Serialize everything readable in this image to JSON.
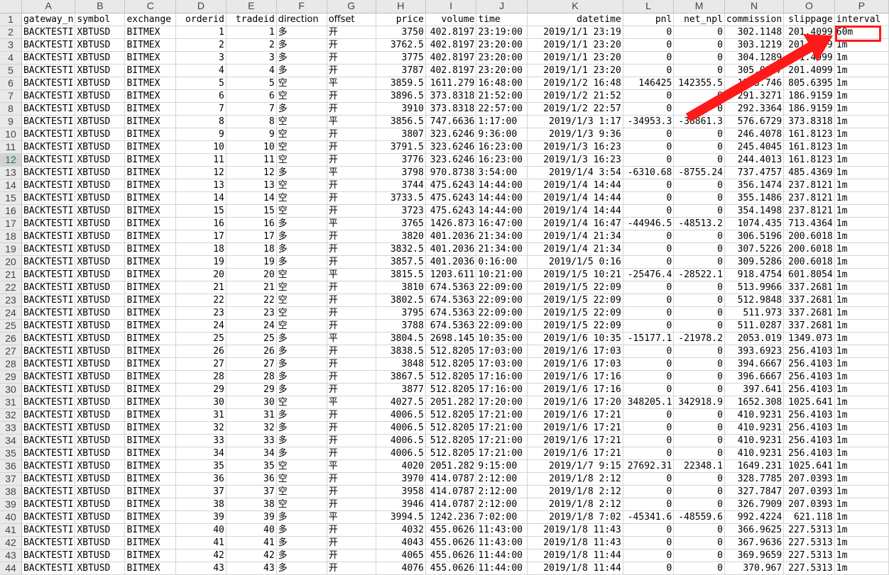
{
  "columns": [
    "A",
    "B",
    "C",
    "D",
    "E",
    "F",
    "G",
    "H",
    "I",
    "J",
    "K",
    "L",
    "M",
    "N",
    "O",
    "P"
  ],
  "header_row": [
    "gateway_n",
    "symbol",
    "exchange",
    "orderid",
    "tradeid",
    "direction",
    "offset",
    "price",
    "volume",
    "time",
    "datetime",
    "pnl",
    "net_npl",
    "commission",
    "slippage",
    "interval"
  ],
  "rows": [
    [
      "BACKTESTI",
      "XBTUSD",
      "BITMEX",
      "1",
      "1",
      "多",
      "开",
      "3750",
      "402.8197",
      "23:19:00",
      "2019/1/1  23:19",
      "0",
      "0",
      "302.1148",
      "201.4099",
      "60m"
    ],
    [
      "BACKTESTI",
      "XBTUSD",
      "BITMEX",
      "2",
      "2",
      "多",
      "开",
      "3762.5",
      "402.8197",
      "23:20:00",
      "2019/1/1  23:20",
      "0",
      "0",
      "303.1219",
      "201.4099",
      "1m"
    ],
    [
      "BACKTESTI",
      "XBTUSD",
      "BITMEX",
      "3",
      "3",
      "多",
      "开",
      "3775",
      "402.8197",
      "23:20:00",
      "2019/1/1  23:20",
      "0",
      "0",
      "304.1289",
      "201.4099",
      "1m"
    ],
    [
      "BACKTESTI",
      "XBTUSD",
      "BITMEX",
      "4",
      "4",
      "多",
      "开",
      "3787",
      "402.8197",
      "23:20:00",
      "2019/1/1  23:20",
      "0",
      "0",
      "305.0847",
      "201.4099",
      "1m"
    ],
    [
      "BACKTESTI",
      "XBTUSD",
      "BITMEX",
      "5",
      "5",
      "空",
      "平",
      "3859.5",
      "1611.279",
      "16:48:00",
      "2019/1/2  16:48",
      "146425",
      "142355.5",
      "1243.746",
      "805.6395",
      "1m"
    ],
    [
      "BACKTESTI",
      "XBTUSD",
      "BITMEX",
      "6",
      "6",
      "空",
      "开",
      "3896.5",
      "373.8318",
      "21:52:00",
      "2019/1/2  21:52",
      "0",
      "0",
      "291.3271",
      "186.9159",
      "1m"
    ],
    [
      "BACKTESTI",
      "XBTUSD",
      "BITMEX",
      "7",
      "7",
      "多",
      "开",
      "3910",
      "373.8318",
      "22:57:00",
      "2019/1/2  22:57",
      "0",
      "0",
      "292.3364",
      "186.9159",
      "1m"
    ],
    [
      "BACKTESTI",
      "XBTUSD",
      "BITMEX",
      "8",
      "8",
      "空",
      "平",
      "3856.5",
      "747.6636",
      "1:17:00",
      "2019/1/3  1:17",
      "-34953.3",
      "-36861.3",
      "576.6729",
      "373.8318",
      "1m"
    ],
    [
      "BACKTESTI",
      "XBTUSD",
      "BITMEX",
      "9",
      "9",
      "空",
      "开",
      "3807",
      "323.6246",
      "9:36:00",
      "2019/1/3  9:36",
      "0",
      "0",
      "246.4078",
      "161.8123",
      "1m"
    ],
    [
      "BACKTESTI",
      "XBTUSD",
      "BITMEX",
      "10",
      "10",
      "空",
      "开",
      "3791.5",
      "323.6246",
      "16:23:00",
      "2019/1/3  16:23",
      "0",
      "0",
      "245.4045",
      "161.8123",
      "1m"
    ],
    [
      "BACKTESTI",
      "XBTUSD",
      "BITMEX",
      "11",
      "11",
      "空",
      "开",
      "3776",
      "323.6246",
      "16:23:00",
      "2019/1/3  16:23",
      "0",
      "0",
      "244.4013",
      "161.8123",
      "1m"
    ],
    [
      "BACKTESTI",
      "XBTUSD",
      "BITMEX",
      "12",
      "12",
      "多",
      "平",
      "3798",
      "970.8738",
      "3:54:00",
      "2019/1/4  3:54",
      "-6310.68",
      "-8755.24",
      "737.4757",
      "485.4369",
      "1m"
    ],
    [
      "BACKTESTI",
      "XBTUSD",
      "BITMEX",
      "13",
      "13",
      "空",
      "开",
      "3744",
      "475.6243",
      "14:44:00",
      "2019/1/4  14:44",
      "0",
      "0",
      "356.1474",
      "237.8121",
      "1m"
    ],
    [
      "BACKTESTI",
      "XBTUSD",
      "BITMEX",
      "14",
      "14",
      "空",
      "开",
      "3733.5",
      "475.6243",
      "14:44:00",
      "2019/1/4  14:44",
      "0",
      "0",
      "355.1486",
      "237.8121",
      "1m"
    ],
    [
      "BACKTESTI",
      "XBTUSD",
      "BITMEX",
      "15",
      "15",
      "空",
      "开",
      "3723",
      "475.6243",
      "14:44:00",
      "2019/1/4  14:44",
      "0",
      "0",
      "354.1498",
      "237.8121",
      "1m"
    ],
    [
      "BACKTESTI",
      "XBTUSD",
      "BITMEX",
      "16",
      "16",
      "多",
      "平",
      "3765",
      "1426.873",
      "16:47:00",
      "2019/1/4  16:47",
      "-44946.5",
      "-48513.2",
      "1074.435",
      "713.4364",
      "1m"
    ],
    [
      "BACKTESTI",
      "XBTUSD",
      "BITMEX",
      "17",
      "17",
      "多",
      "开",
      "3820",
      "401.2036",
      "21:34:00",
      "2019/1/4  21:34",
      "0",
      "0",
      "306.5196",
      "200.6018",
      "1m"
    ],
    [
      "BACKTESTI",
      "XBTUSD",
      "BITMEX",
      "18",
      "18",
      "多",
      "开",
      "3832.5",
      "401.2036",
      "21:34:00",
      "2019/1/4  21:34",
      "0",
      "0",
      "307.5226",
      "200.6018",
      "1m"
    ],
    [
      "BACKTESTI",
      "XBTUSD",
      "BITMEX",
      "19",
      "19",
      "多",
      "开",
      "3857.5",
      "401.2036",
      "0:16:00",
      "2019/1/5  0:16",
      "0",
      "0",
      "309.5286",
      "200.6018",
      "1m"
    ],
    [
      "BACKTESTI",
      "XBTUSD",
      "BITMEX",
      "20",
      "20",
      "空",
      "平",
      "3815.5",
      "1203.611",
      "10:21:00",
      "2019/1/5  10:21",
      "-25476.4",
      "-28522.1",
      "918.4754",
      "601.8054",
      "1m"
    ],
    [
      "BACKTESTI",
      "XBTUSD",
      "BITMEX",
      "21",
      "21",
      "空",
      "开",
      "3810",
      "674.5363",
      "22:09:00",
      "2019/1/5  22:09",
      "0",
      "0",
      "513.9966",
      "337.2681",
      "1m"
    ],
    [
      "BACKTESTI",
      "XBTUSD",
      "BITMEX",
      "22",
      "22",
      "空",
      "开",
      "3802.5",
      "674.5363",
      "22:09:00",
      "2019/1/5  22:09",
      "0",
      "0",
      "512.9848",
      "337.2681",
      "1m"
    ],
    [
      "BACKTESTI",
      "XBTUSD",
      "BITMEX",
      "23",
      "23",
      "空",
      "开",
      "3795",
      "674.5363",
      "22:09:00",
      "2019/1/5  22:09",
      "0",
      "0",
      "511.973",
      "337.2681",
      "1m"
    ],
    [
      "BACKTESTI",
      "XBTUSD",
      "BITMEX",
      "24",
      "24",
      "空",
      "开",
      "3788",
      "674.5363",
      "22:09:00",
      "2019/1/5  22:09",
      "0",
      "0",
      "511.0287",
      "337.2681",
      "1m"
    ],
    [
      "BACKTESTI",
      "XBTUSD",
      "BITMEX",
      "25",
      "25",
      "多",
      "平",
      "3804.5",
      "2698.145",
      "10:35:00",
      "2019/1/6  10:35",
      "-15177.1",
      "-21978.2",
      "2053.019",
      "1349.073",
      "1m"
    ],
    [
      "BACKTESTI",
      "XBTUSD",
      "BITMEX",
      "26",
      "26",
      "多",
      "开",
      "3838.5",
      "512.8205",
      "17:03:00",
      "2019/1/6  17:03",
      "0",
      "0",
      "393.6923",
      "256.4103",
      "1m"
    ],
    [
      "BACKTESTI",
      "XBTUSD",
      "BITMEX",
      "27",
      "27",
      "多",
      "开",
      "3848",
      "512.8205",
      "17:03:00",
      "2019/1/6  17:03",
      "0",
      "0",
      "394.6667",
      "256.4103",
      "1m"
    ],
    [
      "BACKTESTI",
      "XBTUSD",
      "BITMEX",
      "28",
      "28",
      "多",
      "开",
      "3867.5",
      "512.8205",
      "17:16:00",
      "2019/1/6  17:16",
      "0",
      "0",
      "396.6667",
      "256.4103",
      "1m"
    ],
    [
      "BACKTESTI",
      "XBTUSD",
      "BITMEX",
      "29",
      "29",
      "多",
      "开",
      "3877",
      "512.8205",
      "17:16:00",
      "2019/1/6  17:16",
      "0",
      "0",
      "397.641",
      "256.4103",
      "1m"
    ],
    [
      "BACKTESTI",
      "XBTUSD",
      "BITMEX",
      "30",
      "30",
      "空",
      "平",
      "4027.5",
      "2051.282",
      "17:20:00",
      "2019/1/6  17:20",
      "348205.1",
      "342918.9",
      "1652.308",
      "1025.641",
      "1m"
    ],
    [
      "BACKTESTI",
      "XBTUSD",
      "BITMEX",
      "31",
      "31",
      "多",
      "开",
      "4006.5",
      "512.8205",
      "17:21:00",
      "2019/1/6  17:21",
      "0",
      "0",
      "410.9231",
      "256.4103",
      "1m"
    ],
    [
      "BACKTESTI",
      "XBTUSD",
      "BITMEX",
      "32",
      "32",
      "多",
      "开",
      "4006.5",
      "512.8205",
      "17:21:00",
      "2019/1/6  17:21",
      "0",
      "0",
      "410.9231",
      "256.4103",
      "1m"
    ],
    [
      "BACKTESTI",
      "XBTUSD",
      "BITMEX",
      "33",
      "33",
      "多",
      "开",
      "4006.5",
      "512.8205",
      "17:21:00",
      "2019/1/6  17:21",
      "0",
      "0",
      "410.9231",
      "256.4103",
      "1m"
    ],
    [
      "BACKTESTI",
      "XBTUSD",
      "BITMEX",
      "34",
      "34",
      "多",
      "开",
      "4006.5",
      "512.8205",
      "17:21:00",
      "2019/1/6  17:21",
      "0",
      "0",
      "410.9231",
      "256.4103",
      "1m"
    ],
    [
      "BACKTESTI",
      "XBTUSD",
      "BITMEX",
      "35",
      "35",
      "空",
      "平",
      "4020",
      "2051.282",
      "9:15:00",
      "2019/1/7  9:15",
      "27692.31",
      "22348.1",
      "1649.231",
      "1025.641",
      "1m"
    ],
    [
      "BACKTESTI",
      "XBTUSD",
      "BITMEX",
      "36",
      "36",
      "空",
      "开",
      "3970",
      "414.0787",
      "2:12:00",
      "2019/1/8  2:12",
      "0",
      "0",
      "328.7785",
      "207.0393",
      "1m"
    ],
    [
      "BACKTESTI",
      "XBTUSD",
      "BITMEX",
      "37",
      "37",
      "空",
      "开",
      "3958",
      "414.0787",
      "2:12:00",
      "2019/1/8  2:12",
      "0",
      "0",
      "327.7847",
      "207.0393",
      "1m"
    ],
    [
      "BACKTESTI",
      "XBTUSD",
      "BITMEX",
      "38",
      "38",
      "空",
      "开",
      "3946",
      "414.0787",
      "2:12:00",
      "2019/1/8  2:12",
      "0",
      "0",
      "326.7909",
      "207.0393",
      "1m"
    ],
    [
      "BACKTESTI",
      "XBTUSD",
      "BITMEX",
      "39",
      "39",
      "多",
      "平",
      "3994.5",
      "1242.236",
      "7:02:00",
      "2019/1/8  7:02",
      "-45341.6",
      "-48559.6",
      "992.4224",
      "621.118",
      "1m"
    ],
    [
      "BACKTESTI",
      "XBTUSD",
      "BITMEX",
      "40",
      "40",
      "多",
      "开",
      "4032",
      "455.0626",
      "11:43:00",
      "2019/1/8  11:43",
      "0",
      "0",
      "366.9625",
      "227.5313",
      "1m"
    ],
    [
      "BACKTESTI",
      "XBTUSD",
      "BITMEX",
      "41",
      "41",
      "多",
      "开",
      "4043",
      "455.0626",
      "11:43:00",
      "2019/1/8  11:43",
      "0",
      "0",
      "367.9636",
      "227.5313",
      "1m"
    ],
    [
      "BACKTESTI",
      "XBTUSD",
      "BITMEX",
      "42",
      "42",
      "多",
      "开",
      "4065",
      "455.0626",
      "11:44:00",
      "2019/1/8  11:44",
      "0",
      "0",
      "369.9659",
      "227.5313",
      "1m"
    ],
    [
      "BACKTESTI",
      "XBTUSD",
      "BITMEX",
      "43",
      "43",
      "多",
      "开",
      "4076",
      "455.0626",
      "11:44:00",
      "2019/1/8  11:44",
      "0",
      "0",
      "370.967",
      "227.5313",
      "1m"
    ]
  ],
  "selected_row_header": "12",
  "annotation_color": "#ff1a1a",
  "selection_color": "#217346"
}
